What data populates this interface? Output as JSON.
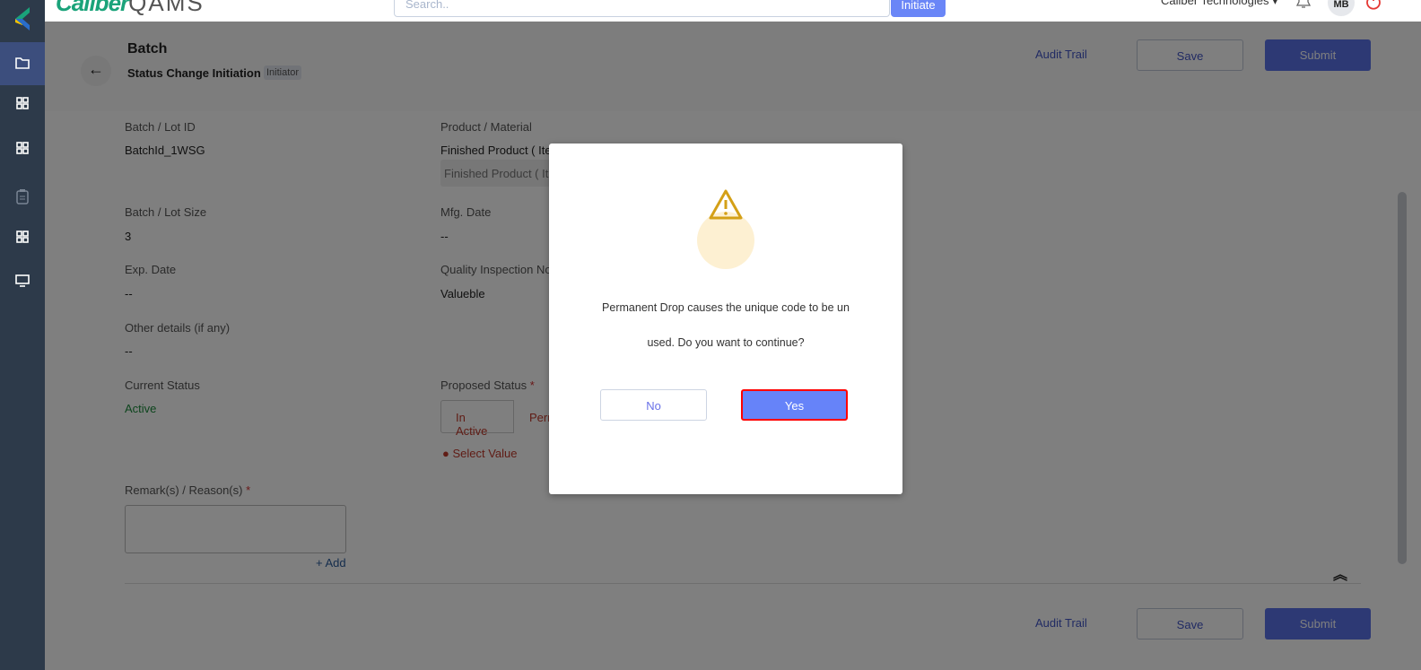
{
  "header": {
    "logo_brand": "Caliber",
    "logo_product": "QAMS",
    "search_placeholder": "Search..",
    "initiate_label": "Initiate",
    "company": "Caliber Technologies",
    "avatar": "MB"
  },
  "sidebar": {
    "items": [
      {
        "icon": "folder-icon",
        "active": true
      },
      {
        "icon": "grid-icon"
      },
      {
        "icon": "grid-icon"
      },
      {
        "icon": "clipboard-icon"
      },
      {
        "icon": "grid-icon"
      },
      {
        "icon": "monitor-icon"
      }
    ]
  },
  "page": {
    "title": "Batch",
    "subtitle": "Status Change Initiation",
    "role_badge": "Initiator",
    "audit_trail": "Audit Trail",
    "save": "Save",
    "submit": "Submit"
  },
  "fields": {
    "batch_id": {
      "label": "Batch / Lot ID",
      "value": "BatchId_1WSG"
    },
    "product": {
      "label": "Product / Material",
      "value": "Finished Product ( Ite",
      "input_value": "Finished Product ( It"
    },
    "batch_size": {
      "label": "Batch / Lot Size",
      "value": "3"
    },
    "mfg_date": {
      "label": "Mfg. Date",
      "value": "--"
    },
    "exp_date": {
      "label": "Exp. Date",
      "value": "--"
    },
    "qi_no": {
      "label": "Quality Inspection No",
      "value": "Valueble"
    },
    "other": {
      "label": "Other details (if any)",
      "value": "--"
    },
    "current_status": {
      "label": "Current Status",
      "value": "Active"
    },
    "proposed_status": {
      "label": "Proposed Status",
      "required": "*",
      "options": [
        "In Active",
        "Perm"
      ],
      "error": "Select Value"
    },
    "remarks": {
      "label": "Remark(s) / Reason(s)",
      "required": "*",
      "value": "",
      "add": "+ Add"
    }
  },
  "modal": {
    "line1": "Permanent Drop causes the unique code to be un",
    "line2": "used. Do you want to continue?",
    "no": "No",
    "yes": "Yes",
    "icon": "warning-icon",
    "accent": "#d4a017"
  }
}
